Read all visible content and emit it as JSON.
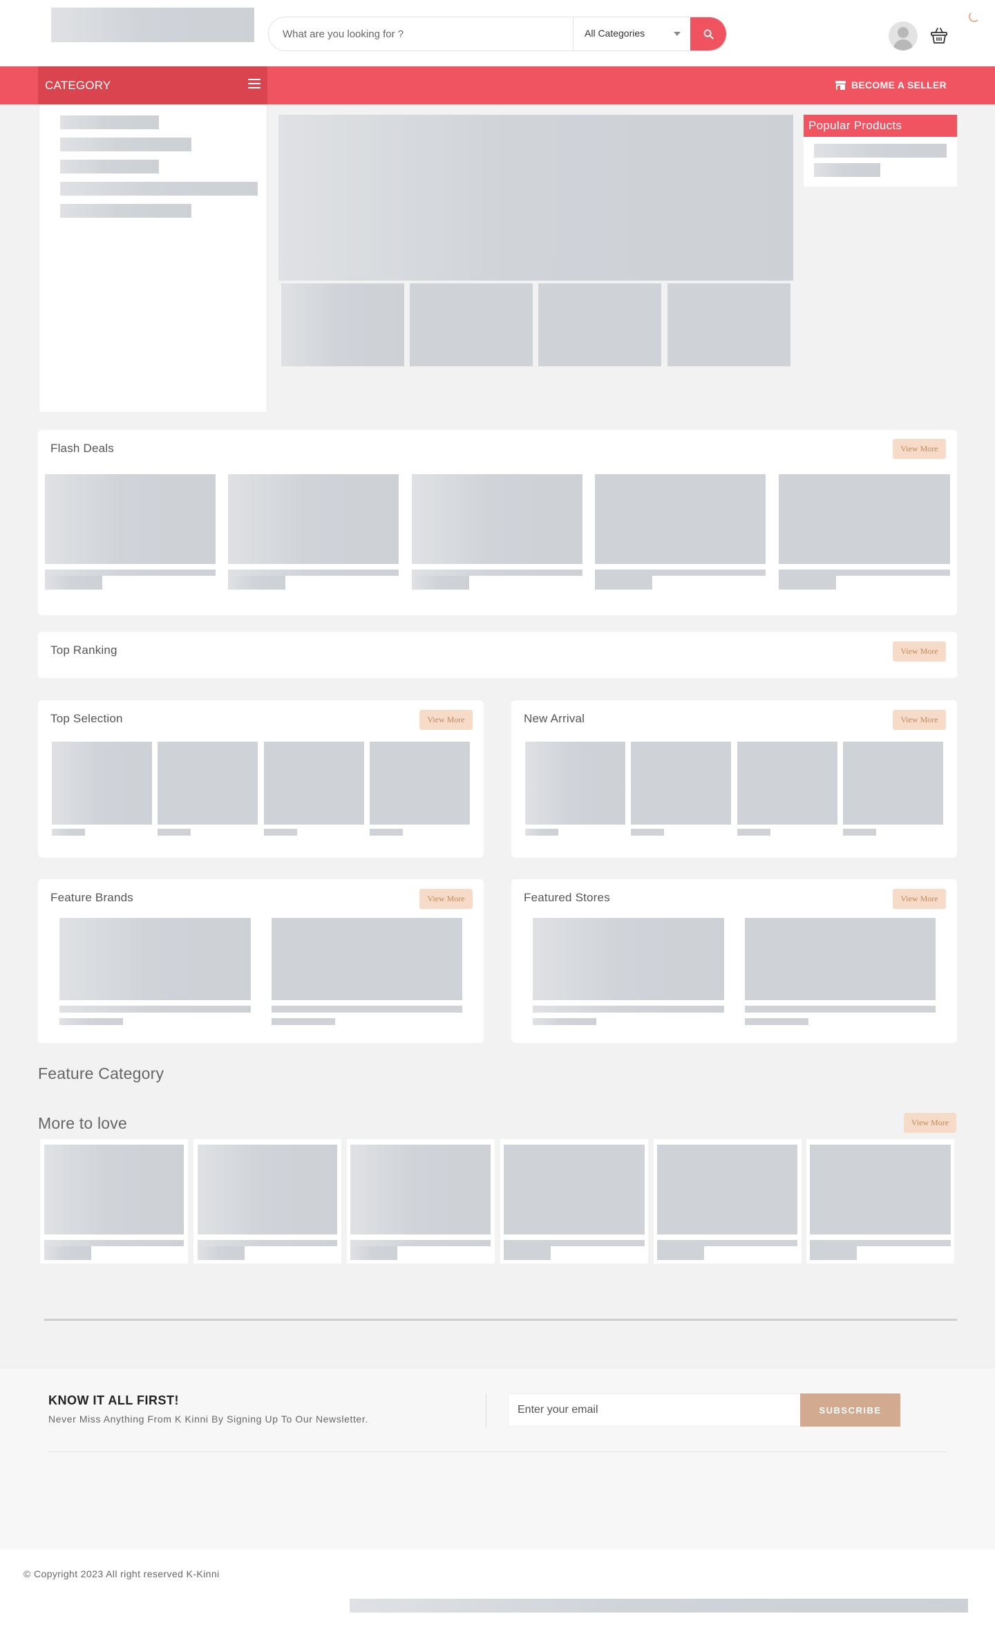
{
  "header": {
    "search_placeholder": "What are you looking for ?",
    "category_select": "All Categories"
  },
  "navbar": {
    "category_label": "CATEGORY",
    "seller_label": "BECOME A SELLER"
  },
  "popular": {
    "title": "Popular Products"
  },
  "sections": {
    "flash_deals": "Flash Deals",
    "top_ranking": "Top Ranking",
    "top_selection": "Top Selection",
    "new_arrival": "New Arrival",
    "feature_brands": "Feature Brands",
    "featured_stores": "Featured Stores",
    "feature_category": "Feature Category",
    "more_to_love": "More to love",
    "view_more": "View More"
  },
  "newsletter": {
    "title": "KNOW IT ALL FIRST!",
    "subtitle": "Never Miss Anything From K Kinni By Signing Up To Our Newsletter.",
    "email_placeholder": "Enter your email",
    "subscribe": "SUBSCRIBE"
  },
  "footer": {
    "copyright": "© Copyright 2023 All right reserved K-Kinni"
  },
  "colors": {
    "brand": "#f05461",
    "brand_dark": "#d9444f",
    "accent": "#d2aa90",
    "view_more_bg": "#f6dcc8",
    "skeleton": "#cfd3d8"
  }
}
